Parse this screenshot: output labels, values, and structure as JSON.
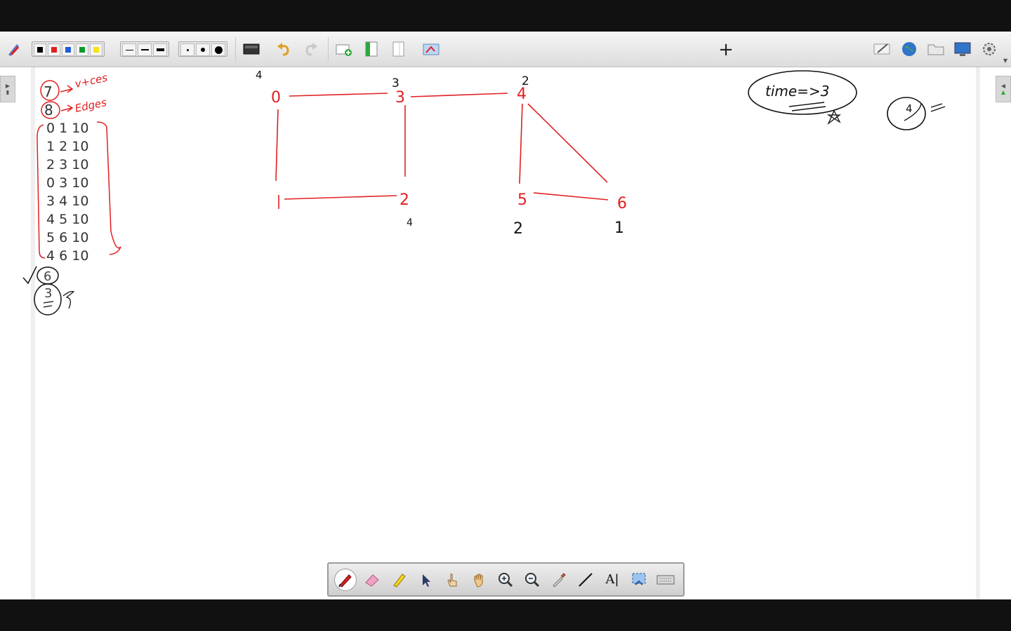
{
  "toolbar": {
    "colors": [
      "#000000",
      "#e02020",
      "#1a5ed8",
      "#0a9a2a",
      "#f5e21a"
    ],
    "add_page_symbol": "+"
  },
  "edge_list": [
    {
      "text": "0 1 10"
    },
    {
      "text": "1 2 10"
    },
    {
      "text": "2 3 10"
    },
    {
      "text": "0 3 10"
    },
    {
      "text": "3 4 10"
    },
    {
      "text": "4 5 10"
    },
    {
      "text": "5 6 10"
    },
    {
      "text": "4 6 10"
    }
  ],
  "handwriting": {
    "vertices_count": "7",
    "vertices_label": "v+ces",
    "edges_count": "8",
    "edges_label": "Edges",
    "start_node": "6",
    "answer_value": "3",
    "time_note": "time=>3",
    "circled_value": "4",
    "node_labels": [
      "0",
      "1",
      "2",
      "3",
      "4",
      "5",
      "6"
    ],
    "node_times": [
      {
        "node": "0",
        "value": "4"
      },
      {
        "node": "3",
        "value": "3"
      },
      {
        "node": "4",
        "value": "2"
      },
      {
        "node": "2",
        "value": "4"
      },
      {
        "node": "5",
        "value": "2"
      },
      {
        "node": "6",
        "value": "1"
      }
    ]
  },
  "floating_toolbar": {
    "tools": [
      "pen",
      "eraser",
      "highlighter",
      "select",
      "pointer",
      "pan",
      "zoom-in",
      "zoom-out",
      "color-picker",
      "line",
      "text",
      "screen-capture",
      "keyboard"
    ],
    "text_tool_label": "A"
  }
}
